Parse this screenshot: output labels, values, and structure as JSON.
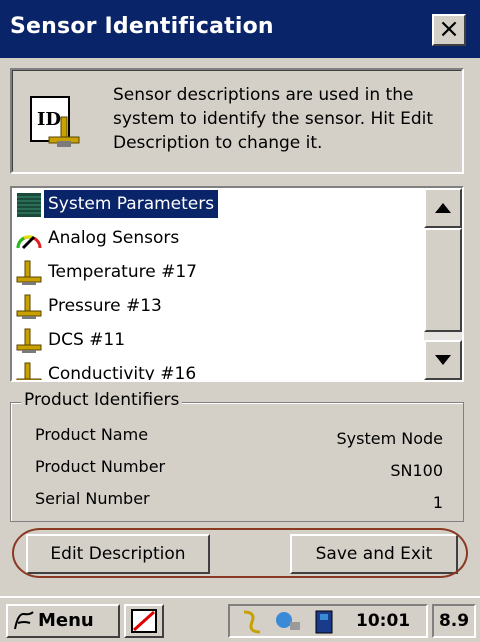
{
  "window": {
    "title": "Sensor Identification",
    "close_label": "×"
  },
  "info": {
    "icon": "id-icon",
    "description": "Sensor descriptions are used in the system to identify the sensor. Hit Edit Description to change it."
  },
  "sensor_list": {
    "items": [
      {
        "label": "System Parameters",
        "icon": "system-parameters-icon",
        "selected": true
      },
      {
        "label": "Analog Sensors",
        "icon": "analog-gauge-icon",
        "selected": false
      },
      {
        "label": "Temperature #17",
        "icon": "sensor-probe-icon",
        "selected": false
      },
      {
        "label": "Pressure #13",
        "icon": "sensor-probe-icon",
        "selected": false
      },
      {
        "label": "DCS #11",
        "icon": "sensor-probe-icon",
        "selected": false
      },
      {
        "label": "Conductivity #16",
        "icon": "sensor-probe-icon",
        "selected": false
      }
    ]
  },
  "product": {
    "legend": "Product Identifiers",
    "rows": [
      {
        "key": "Product Name",
        "value": "System Node"
      },
      {
        "key": "Product Number",
        "value": "SN100"
      },
      {
        "key": "Serial Number",
        "value": "1"
      }
    ]
  },
  "buttons": {
    "edit": "Edit Description",
    "save": "Save and Exit"
  },
  "taskbar": {
    "menu_label": "Menu",
    "clock": "10:01",
    "version": "8.9"
  },
  "colors": {
    "titlebar": "#0a246a",
    "face": "#d4d0c8",
    "selection": "#0a246a",
    "highlight_oval": "#8a3a24"
  }
}
